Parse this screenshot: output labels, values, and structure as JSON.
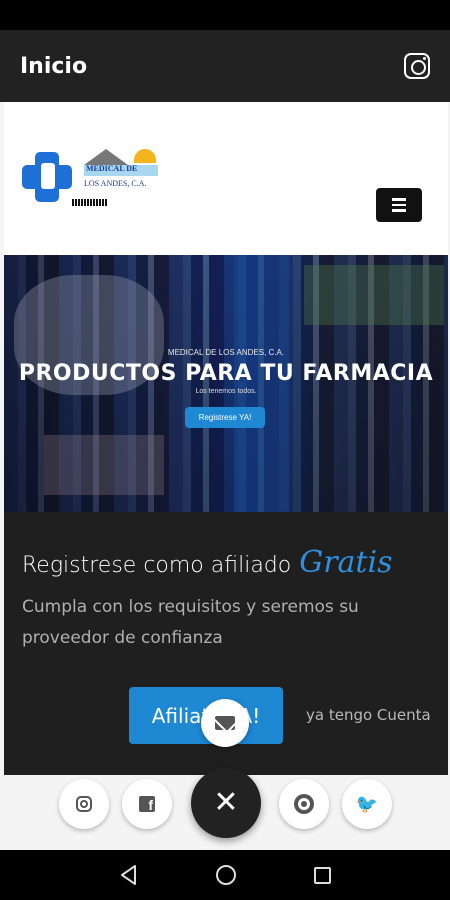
{
  "app_bar": {
    "title": "Inicio",
    "icon": "instagram-icon"
  },
  "site": {
    "logo": {
      "line1": "MEDICAL DE",
      "line2": "LOS ANDES, C.A."
    },
    "menu_icon": "hamburger-icon",
    "hero": {
      "company": "MEDICAL DE LOS ANDES, C.A.",
      "title": "PRODUCTOS PARA TU FARMACIA",
      "subtitle": "Los tenemos todos.",
      "button": "Registrese YA!"
    },
    "register": {
      "heading": "Registrese como afiliado",
      "highlight": "Gratis",
      "description": "Cumpla con los requisitos y seremos su proveedor de confianza",
      "primary_button": "Afiliate YA!",
      "secondary_link": "ya tengo Cuenta"
    }
  },
  "fab": {
    "mail_icon": "mail-icon",
    "close_icon": "close-icon",
    "close_glyph": "✕"
  },
  "share": [
    {
      "name": "instagram",
      "icon": "instagram-icon"
    },
    {
      "name": "facebook",
      "icon": "facebook-icon",
      "glyph": "f"
    },
    {
      "name": "whatsapp",
      "icon": "whatsapp-icon"
    },
    {
      "name": "twitter",
      "icon": "twitter-icon",
      "glyph": "🐦"
    }
  ],
  "colors": {
    "accent": "#1e88d3",
    "app_bar": "#222222",
    "dark_section": "#1f1f1f",
    "gratis": "#2e90e0"
  }
}
